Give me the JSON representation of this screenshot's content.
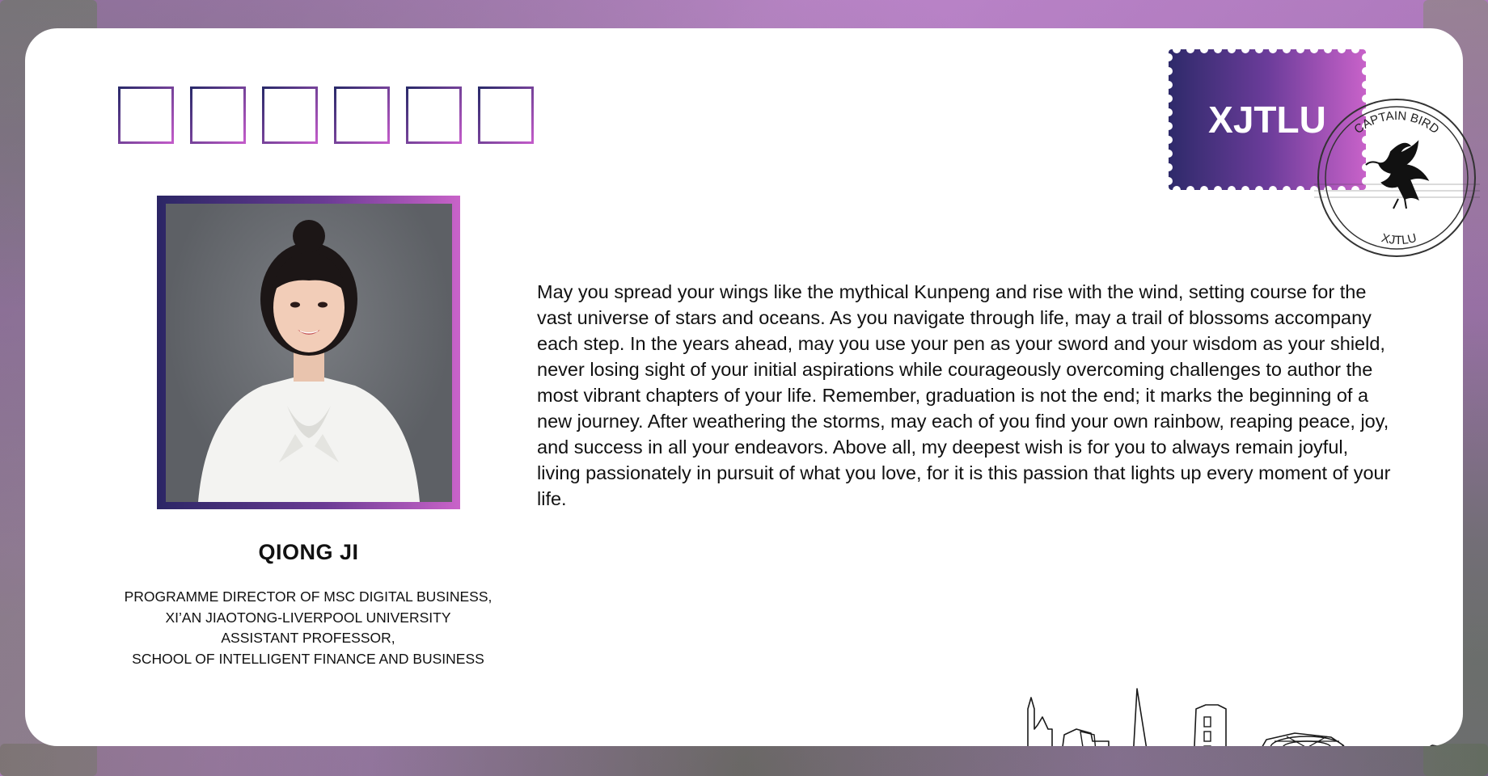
{
  "colors": {
    "accent_dark": "#2b2665",
    "accent_mid": "#6a3b94",
    "accent_light": "#c963c9",
    "card": "#ffffff",
    "text": "#111111"
  },
  "stamp_boxes": {
    "count": 6
  },
  "postage": {
    "label": "XJTLU"
  },
  "seal": {
    "top_text": "CAPTAIN BIRD",
    "bottom_text": "XJTLU",
    "icon": "liver-bird-icon"
  },
  "profile": {
    "name": "QIONG JI",
    "title_lines": [
      "PROGRAMME  DIRECTOR  OF MSC DIGITAL  BUSINESS,",
      "XI’AN JIAOTONG-LIVERPOOL  UNIVERSITY",
      "ASSISTANT PROFESSOR,",
      "SCHOOL OF INTELLIGENT  FINANCE AND BUSINESS"
    ]
  },
  "message": "May you spread your wings like the mythical Kunpeng and rise with the wind, setting course for the vast universe of stars and oceans. As you navigate through life, may a trail of blossoms accompany each step. In the years ahead, may you use your pen as your sword and your wisdom as your shield, never losing sight of your initial aspirations while courageously overcoming challenges to author the most vibrant chapters of your life. Remember, graduation is not the end; it marks the beginning of a new journey. After weathering the storms, may each of you find your own rainbow, reaping peace, joy, and success in all your endeavors. Above all, my deepest wish is for you to always remain joyful, living passionately in pursuit of what you love, for it is this passion that lights up every moment of your life."
}
